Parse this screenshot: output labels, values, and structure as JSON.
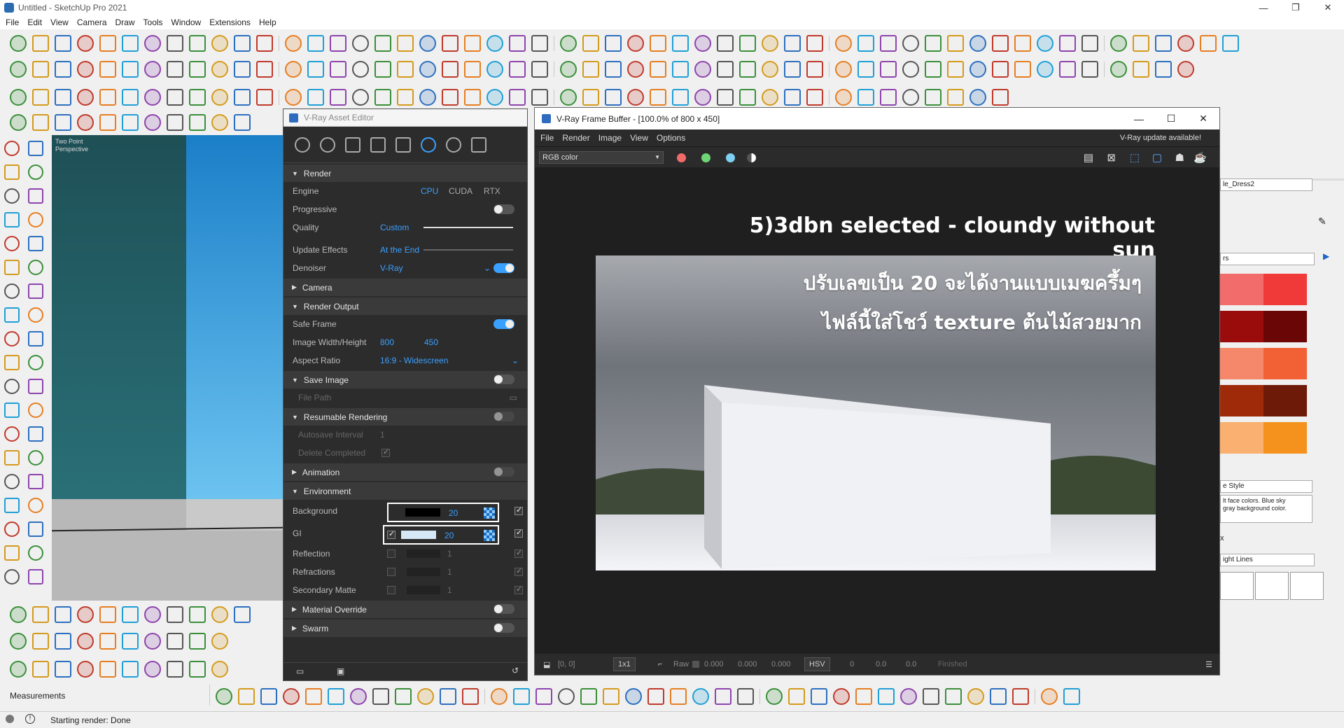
{
  "window": {
    "title": "Untitled - SketchUp Pro 2021",
    "minimize": "—",
    "maximize": "❐",
    "close": "✕"
  },
  "menubar": [
    "File",
    "Edit",
    "View",
    "Camera",
    "Draw",
    "Tools",
    "Window",
    "Extensions",
    "Help"
  ],
  "viewport": {
    "label_line1": "Two Point",
    "label_line2": "Perspective"
  },
  "asset_editor": {
    "title": "V-Ray Asset Editor",
    "render_section": "Render",
    "engine_label": "Engine",
    "engine_options": [
      "CPU",
      "CUDA",
      "RTX"
    ],
    "progressive_label": "Progressive",
    "quality_label": "Quality",
    "quality_value": "Custom",
    "update_effects_label": "Update Effects",
    "update_effects_value": "At the End",
    "denoiser_label": "Denoiser",
    "denoiser_value": "V-Ray",
    "camera_section": "Camera",
    "render_output_section": "Render Output",
    "safe_frame_label": "Safe Frame",
    "image_wh_label": "Image Width/Height",
    "width": "800",
    "height": "450",
    "aspect_label": "Aspect Ratio",
    "aspect_value": "16:9 - Widescreen",
    "save_image_section": "Save Image",
    "file_path_label": "File Path",
    "resumable_section": "Resumable Rendering",
    "autosave_label": "Autosave Interval",
    "autosave_value": "1",
    "delete_completed_label": "Delete Completed",
    "animation_section": "Animation",
    "environment_section": "Environment",
    "background_label": "Background",
    "background_value": "20",
    "gi_label": "GI",
    "gi_value": "20",
    "reflection_label": "Reflection",
    "reflection_value": "1",
    "refractions_label": "Refractions",
    "refractions_value": "1",
    "secondary_matte_label": "Secondary Matte",
    "secondary_matte_value": "1",
    "material_override_section": "Material Override",
    "swarm_section": "Swarm"
  },
  "frame_buffer": {
    "title": "V-Ray Frame Buffer - [100.0% of 800 x 450]",
    "menu": [
      "File",
      "Render",
      "Image",
      "View",
      "Options"
    ],
    "update_notice": "V-Ray update available!",
    "channel": "RGB color",
    "heading": "5)3dbn selected - cloundy without sun",
    "thai_line1": "ปรับเลขเป็น 20 จะได้งานแบบเมฆครึ้มๆ",
    "thai_line2": "ไฟล์นี้ใส่โชว์ texture ต้นไม้สวยมาก",
    "status_coords": "[0, 0]",
    "status_zoom": "1x1",
    "status_raw": "Raw",
    "status_v1": "0.000",
    "status_v2": "0.000",
    "status_v3": "0.000",
    "status_mode": "HSV",
    "status_h": "0",
    "status_s": "0.0",
    "status_v": "0.0",
    "status_state": "Finished"
  },
  "right_panel": {
    "material_name": "le_Dress2",
    "colors_label": "rs",
    "style_name": "e Style",
    "style_desc1": "lt face colors. Blue sky",
    "style_desc2": "gray background color.",
    "close_x": "x",
    "lines_label": "ight Lines",
    "swatch_colors": [
      "#f26c6c",
      "#f03a3a",
      "#9a0b0b",
      "#6a0606",
      "#f5876a",
      "#f26035",
      "#9e2a0a",
      "#6e1a08",
      "#f9b070",
      "#f5921e"
    ]
  },
  "measurements_label": "Measurements",
  "status_message": "Starting render: Done"
}
